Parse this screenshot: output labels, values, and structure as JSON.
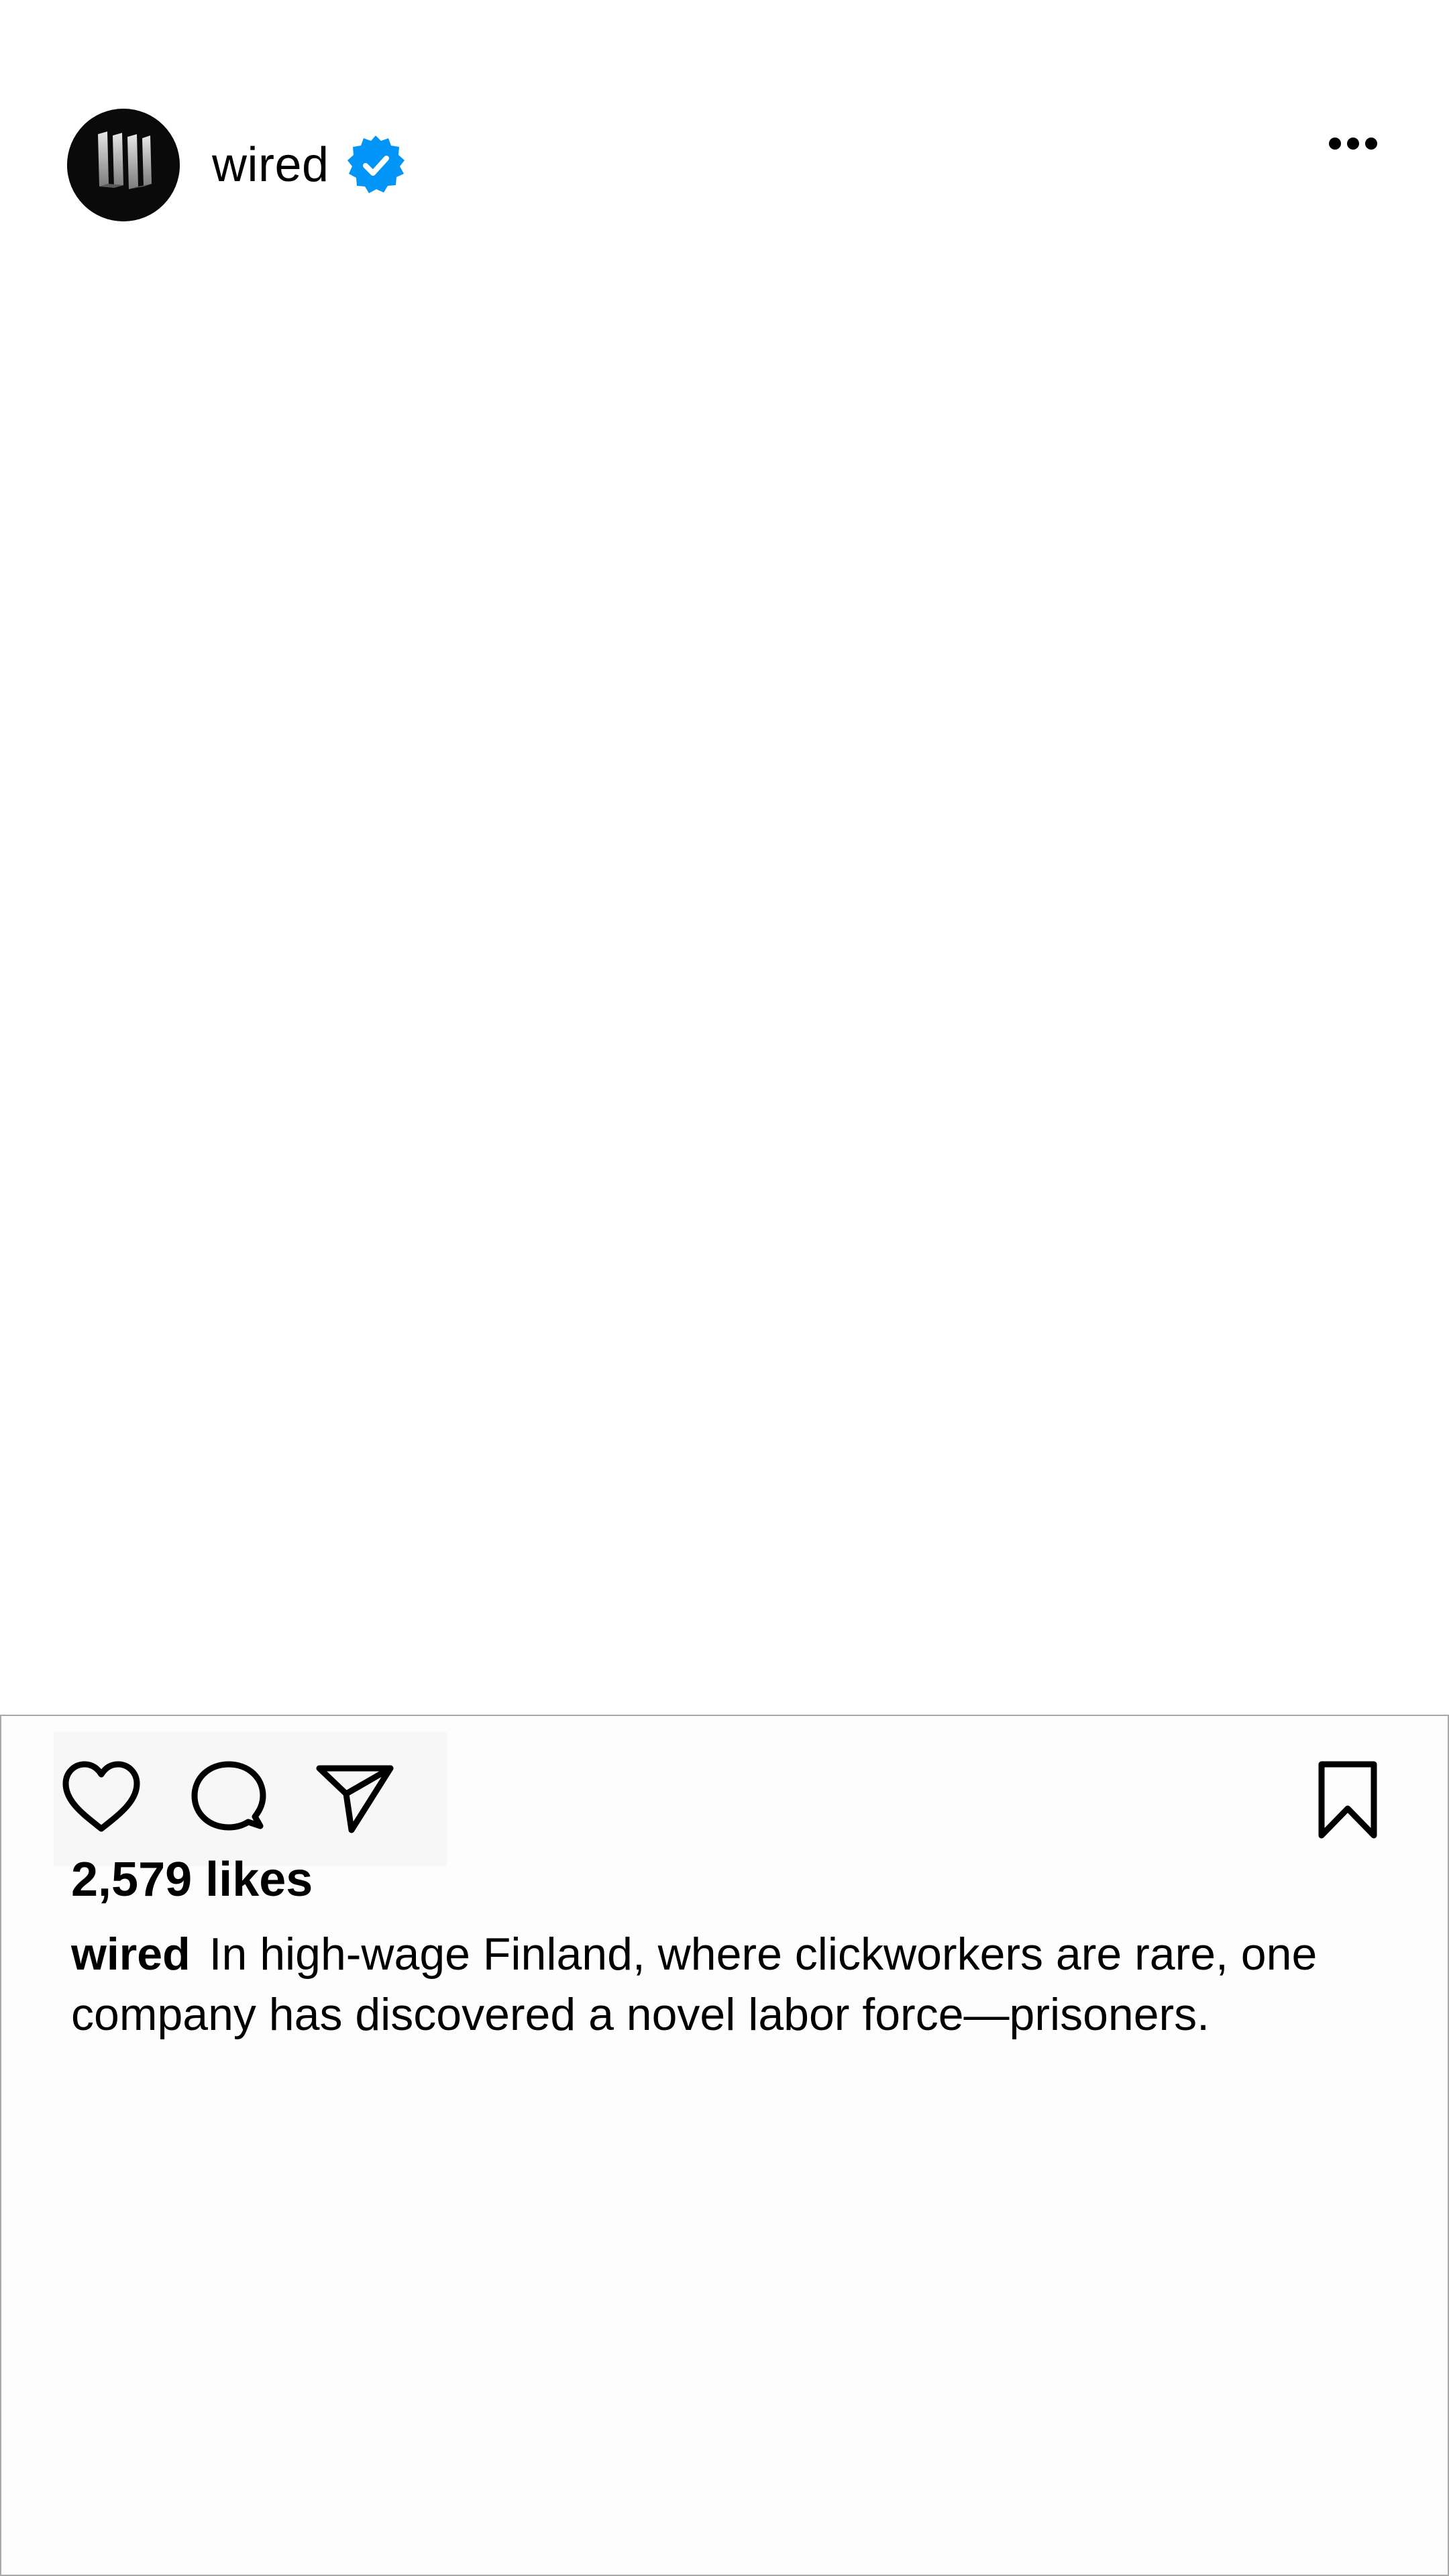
{
  "header": {
    "username": "wired",
    "avatar_icon": "wired-logo-icon",
    "verified_icon": "verified-badge-icon",
    "more_icon": "more-options-icon"
  },
  "actions": {
    "like_icon": "heart-icon",
    "comment_icon": "comment-icon",
    "share_icon": "paper-plane-icon",
    "save_icon": "bookmark-icon"
  },
  "post": {
    "likes_text": "2,579 likes",
    "caption_username": "wired",
    "caption_text": "In high-wage Finland, where clickworkers are rare, one company has discovered a novel labor force—prisoners."
  },
  "colors": {
    "verified_blue": "#0095f6",
    "text": "#000000",
    "panel_border": "#a9a9a9"
  }
}
